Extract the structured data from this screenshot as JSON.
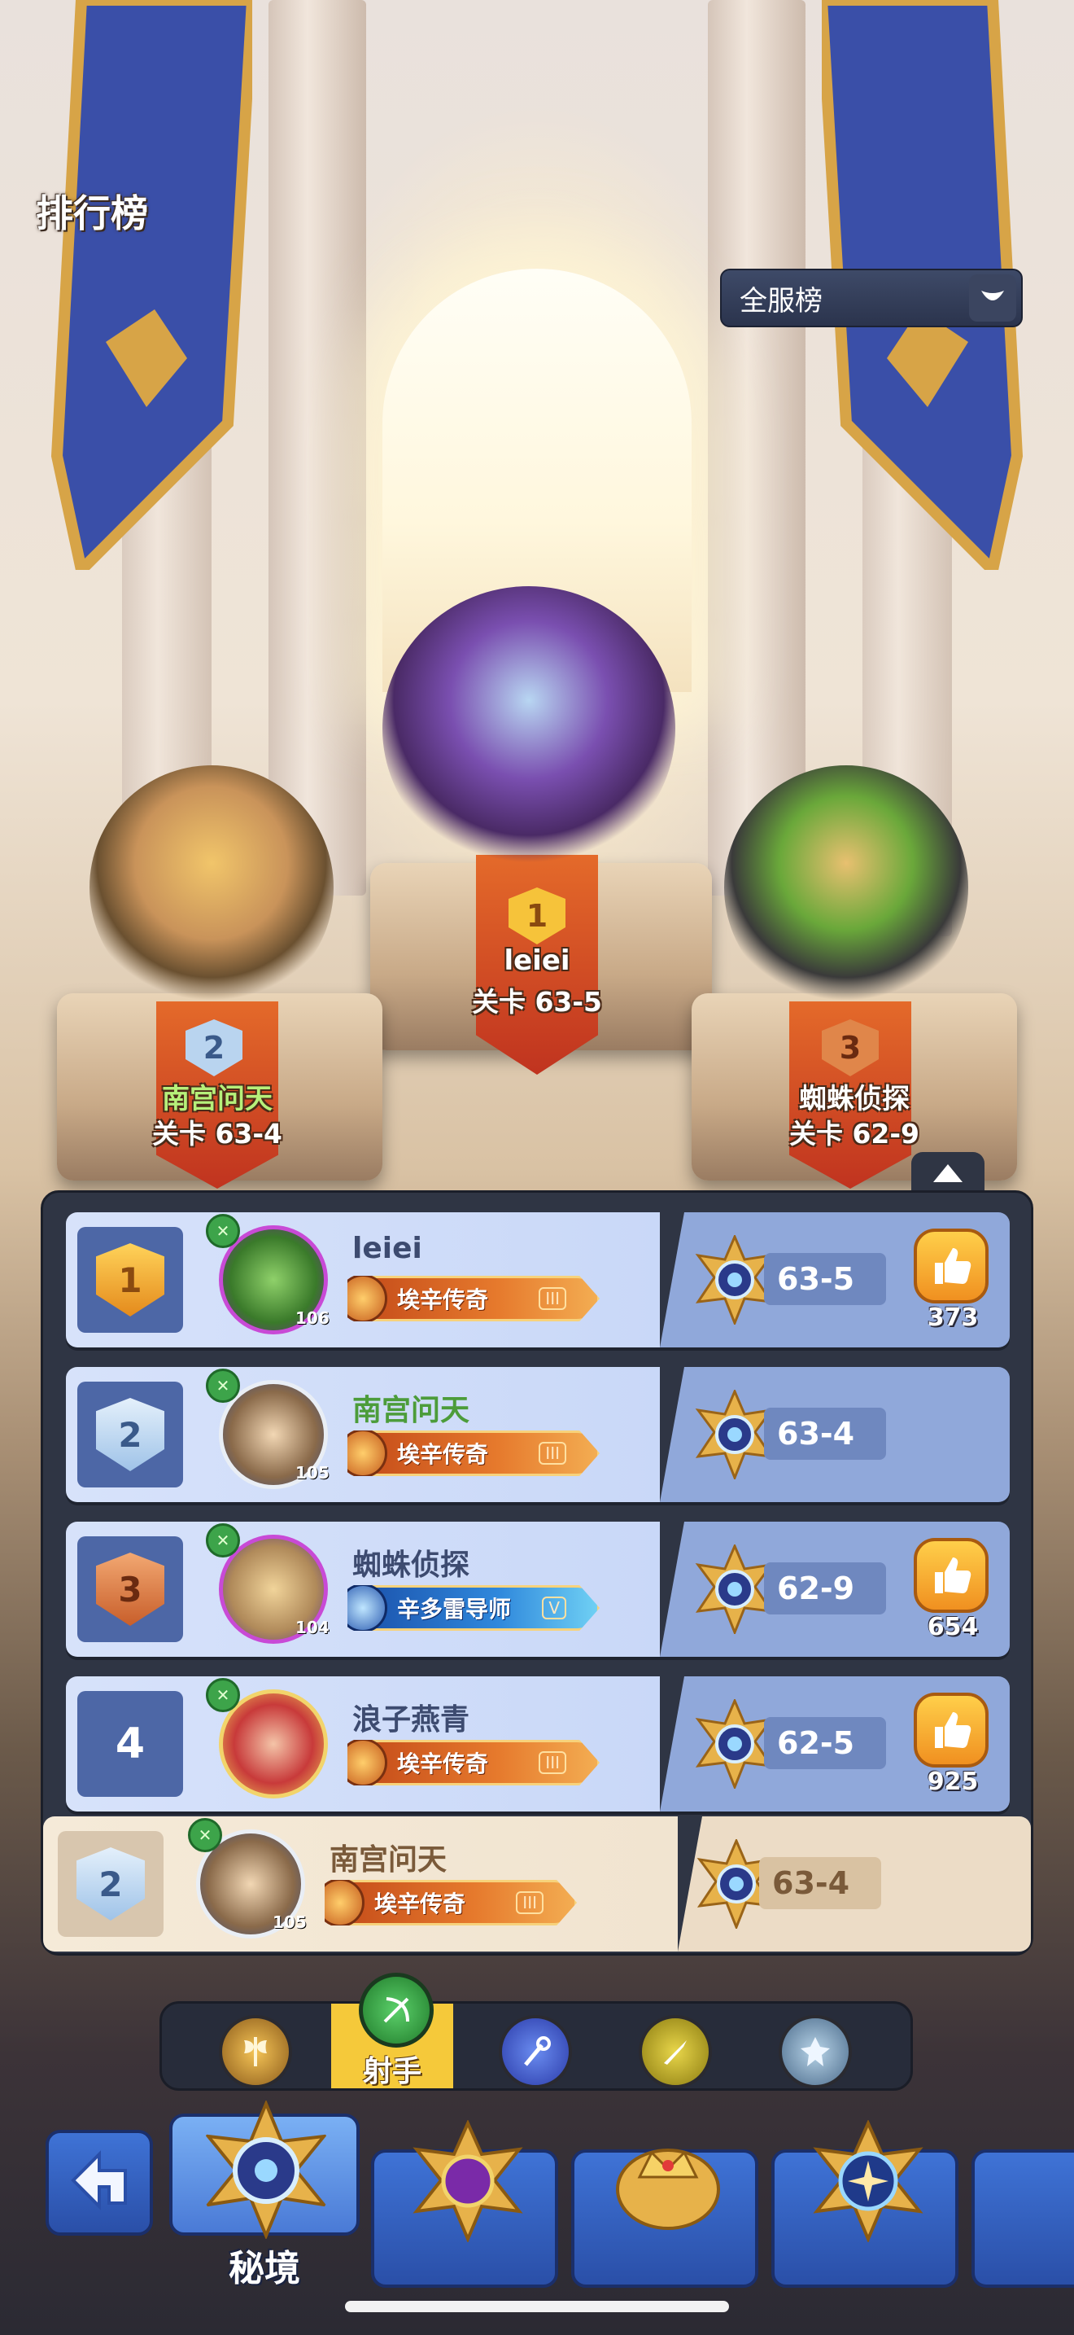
{
  "header": {
    "title": "排行榜"
  },
  "filter": {
    "selected": "全服榜"
  },
  "podium": [
    {
      "rank": "1",
      "name": "leiei",
      "stage": "关卡 63-5",
      "name_color": "#ffffff"
    },
    {
      "rank": "2",
      "name": "南宫问天",
      "stage": "关卡 63-4",
      "name_color": "#b6f07a"
    },
    {
      "rank": "3",
      "name": "蜘蛛侦探",
      "stage": "关卡 62-9",
      "name_color": "#ffffff"
    }
  ],
  "leaderboard": {
    "rows": [
      {
        "rank": "1",
        "name": "leiei",
        "name_color": "#3d4b70",
        "level": "106",
        "title": "埃辛传奇",
        "title_tier": "III",
        "stage": "63-5",
        "likes": "373",
        "rank_color": "#f2a82a"
      },
      {
        "rank": "2",
        "name": "南宫问天",
        "name_color": "#4c9c3a",
        "level": "105",
        "title": "埃辛传奇",
        "title_tier": "III",
        "stage": "63-4",
        "likes": "",
        "rank_color": "#9fc3e8"
      },
      {
        "rank": "3",
        "name": "蜘蛛侦探",
        "name_color": "#3d4b70",
        "level": "104",
        "title": "辛多雷导师",
        "title_tier": "V",
        "stage": "62-9",
        "likes": "654",
        "rank_color": "#e0864a"
      },
      {
        "rank": "4",
        "name": "浪子燕青",
        "name_color": "#3d4b70",
        "level": "",
        "title": "埃辛传奇",
        "title_tier": "III",
        "stage": "62-5",
        "likes": "925",
        "rank_color": ""
      }
    ],
    "self": {
      "rank": "2",
      "name": "南宫问天",
      "level": "105",
      "title": "埃辛传奇",
      "title_tier": "III",
      "stage": "63-4"
    }
  },
  "class_tabs": {
    "selected_label": "射手",
    "icons": [
      "axe-icon",
      "bow-icon",
      "staff-icon",
      "dagger-icon",
      "holy-icon"
    ]
  },
  "bottom_nav": {
    "selected_label": "秘境"
  },
  "colors": {
    "accent_gold": "#f2c44a",
    "panel": "#2f3544",
    "row_blue": "#d7e2fa",
    "selected_tab": "#f5c93a"
  }
}
